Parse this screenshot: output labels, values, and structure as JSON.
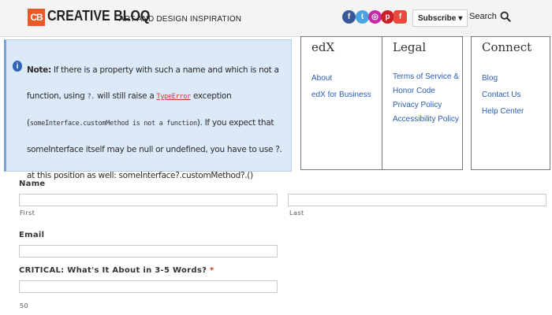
{
  "header": {
    "logo_mark": "CB",
    "logo_text": "CREATIVE BLOQ",
    "tagline": "ART AND DESIGN INSPIRATION",
    "social": [
      {
        "name": "facebook-icon",
        "glyph": "f"
      },
      {
        "name": "twitter-icon",
        "glyph": "t"
      },
      {
        "name": "instagram-icon",
        "glyph": "◎"
      },
      {
        "name": "pinterest-icon",
        "glyph": "p"
      },
      {
        "name": "flipboard-icon",
        "glyph": "f"
      }
    ],
    "subscribe_label": "Subscribe",
    "search_label": "Search"
  },
  "note": {
    "label": "Note:",
    "text_1": " If there is a property with such a name and which is not a function, using ",
    "code_1": "?.",
    "text_2": " will still raise a ",
    "code_link": "TypeError",
    "text_3": " exception (",
    "code_2": "someInterface.customMethod is not a function",
    "text_4": "). If you expect that someInterface itself may be null or undefined, you have to use ?. at this position as well: someInterface?.customMethod?.()"
  },
  "footer_columns": [
    {
      "title": "edX",
      "links": [
        "About",
        "edX for Business"
      ]
    },
    {
      "title": "Legal",
      "links": [
        "Terms of Service &",
        "Honor Code",
        "Privacy Policy",
        "Accessibility Policy"
      ]
    },
    {
      "title": "Connect",
      "links": [
        "Blog",
        "Contact Us",
        "Help Center"
      ]
    }
  ],
  "form": {
    "name_label": "Name",
    "first_sublabel": "First",
    "last_sublabel": "Last",
    "first_value": "",
    "last_value": "",
    "email_label": "Email",
    "email_value": "",
    "critical_label": "CRITICAL: What's It About in 3-5 Words?",
    "required_mark": "*",
    "critical_value": "",
    "counter": "50"
  }
}
